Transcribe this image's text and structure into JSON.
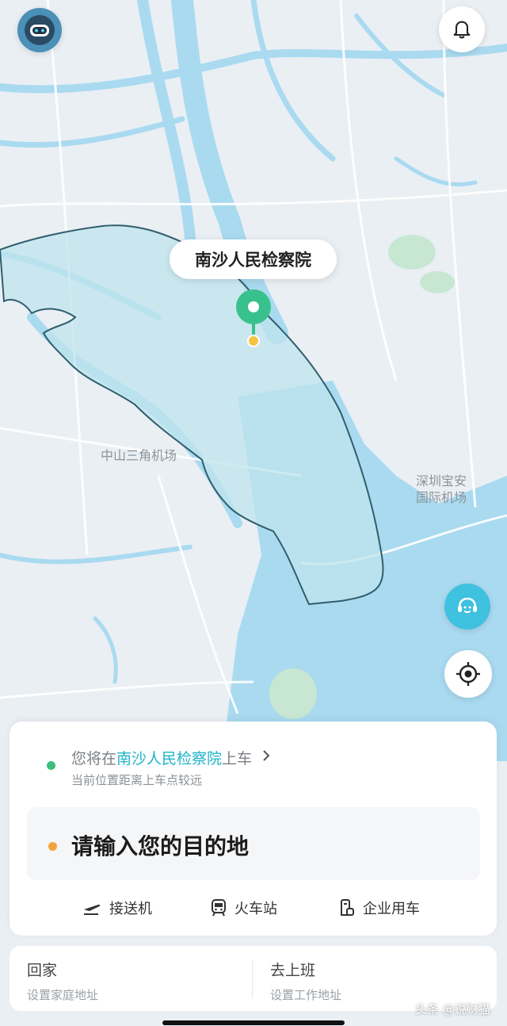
{
  "map": {
    "place_label": "南沙人民检察院",
    "airport_zhongshan": "中山三角机场",
    "airport_shenzhen_line1": "深圳宝安",
    "airport_shenzhen_line2": "国际机场",
    "colors": {
      "water": "#a9daf0",
      "land": "#eaeff4",
      "district_fill": "#bfe4ee",
      "district_border": "#2f5e6c",
      "pin": "#39c18d"
    }
  },
  "top": {
    "avatar_icon": "robot-avatar-icon",
    "bell_icon": "bell-icon"
  },
  "side": {
    "service_icon": "customer-service-icon",
    "locate_icon": "locate-icon"
  },
  "trip": {
    "pickup_prefix": "您将在",
    "pickup_place": "南沙人民检察院",
    "pickup_suffix": "上车",
    "pickup_sub": "当前位置距离上车点较远",
    "destination_placeholder": "请输入您的目的地",
    "quick": [
      {
        "label": "接送机",
        "icon": "airplane-icon"
      },
      {
        "label": "火车站",
        "icon": "train-icon"
      },
      {
        "label": "企业用车",
        "icon": "company-car-icon"
      }
    ]
  },
  "addresses": {
    "home_title": "回家",
    "home_sub": "设置家庭地址",
    "work_title": "去上班",
    "work_sub": "设置工作地址"
  },
  "watermark": "头条 @说财猫"
}
